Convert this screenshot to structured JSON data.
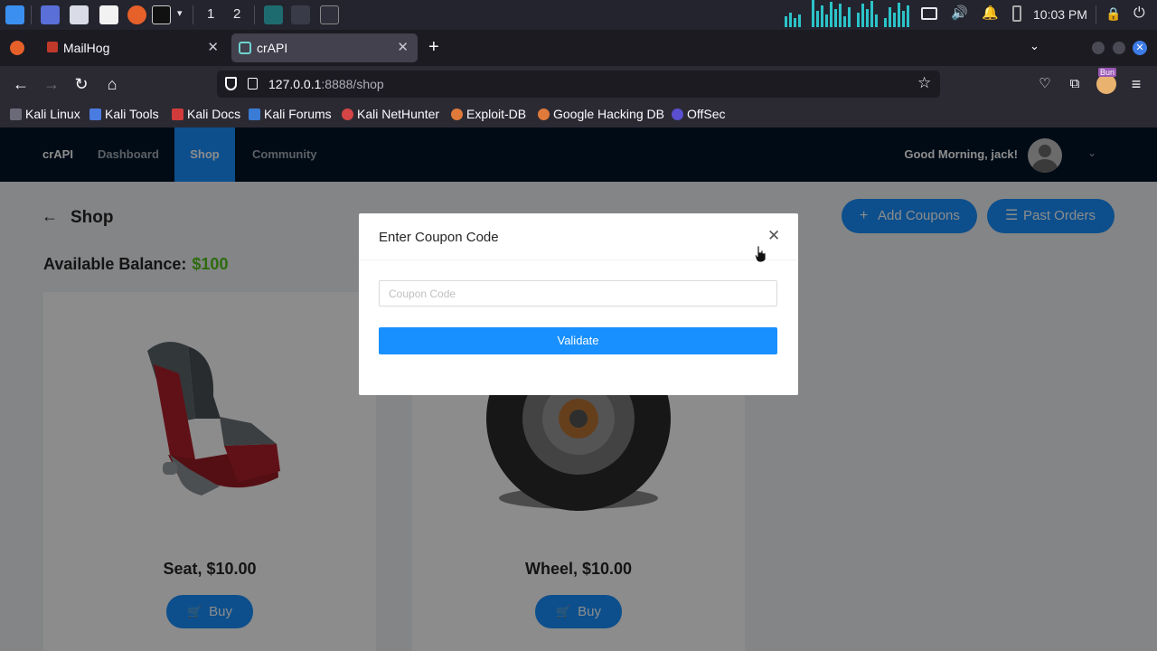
{
  "taskbar": {
    "workspaces": [
      "1",
      "2"
    ],
    "clock": "10:03 PM"
  },
  "browser": {
    "tabs": [
      {
        "label": "MailHog",
        "active": false
      },
      {
        "label": "crAPI",
        "active": true
      }
    ],
    "url_host": "127.0.0.1",
    "url_rest": ":8888/shop",
    "bookmarks": [
      "Kali Linux",
      "Kali Tools",
      "Kali Docs",
      "Kali Forums",
      "Kali NetHunter",
      "Exploit-DB",
      "Google Hacking DB",
      "OffSec"
    ],
    "extension_badge": "Bun"
  },
  "app": {
    "brand": "crAPI",
    "nav": [
      "Dashboard",
      "Shop",
      "Community"
    ],
    "active_nav": "Shop",
    "greeting": "Good Morning, jack!",
    "accent_color": "#1890ff",
    "navbar_color": "#001529"
  },
  "shop": {
    "title": "Shop",
    "balance_label": "Available Balance:",
    "balance_value": "$100",
    "add_coupons_label": "Add Coupons",
    "past_orders_label": "Past Orders",
    "products": [
      {
        "name": "Seat, $10.00",
        "buy_label": "Buy"
      },
      {
        "name": "Wheel, $10.00",
        "buy_label": "Buy"
      }
    ]
  },
  "modal": {
    "title": "Enter Coupon Code",
    "input_placeholder": "Coupon Code",
    "input_value": "",
    "validate_label": "Validate"
  }
}
